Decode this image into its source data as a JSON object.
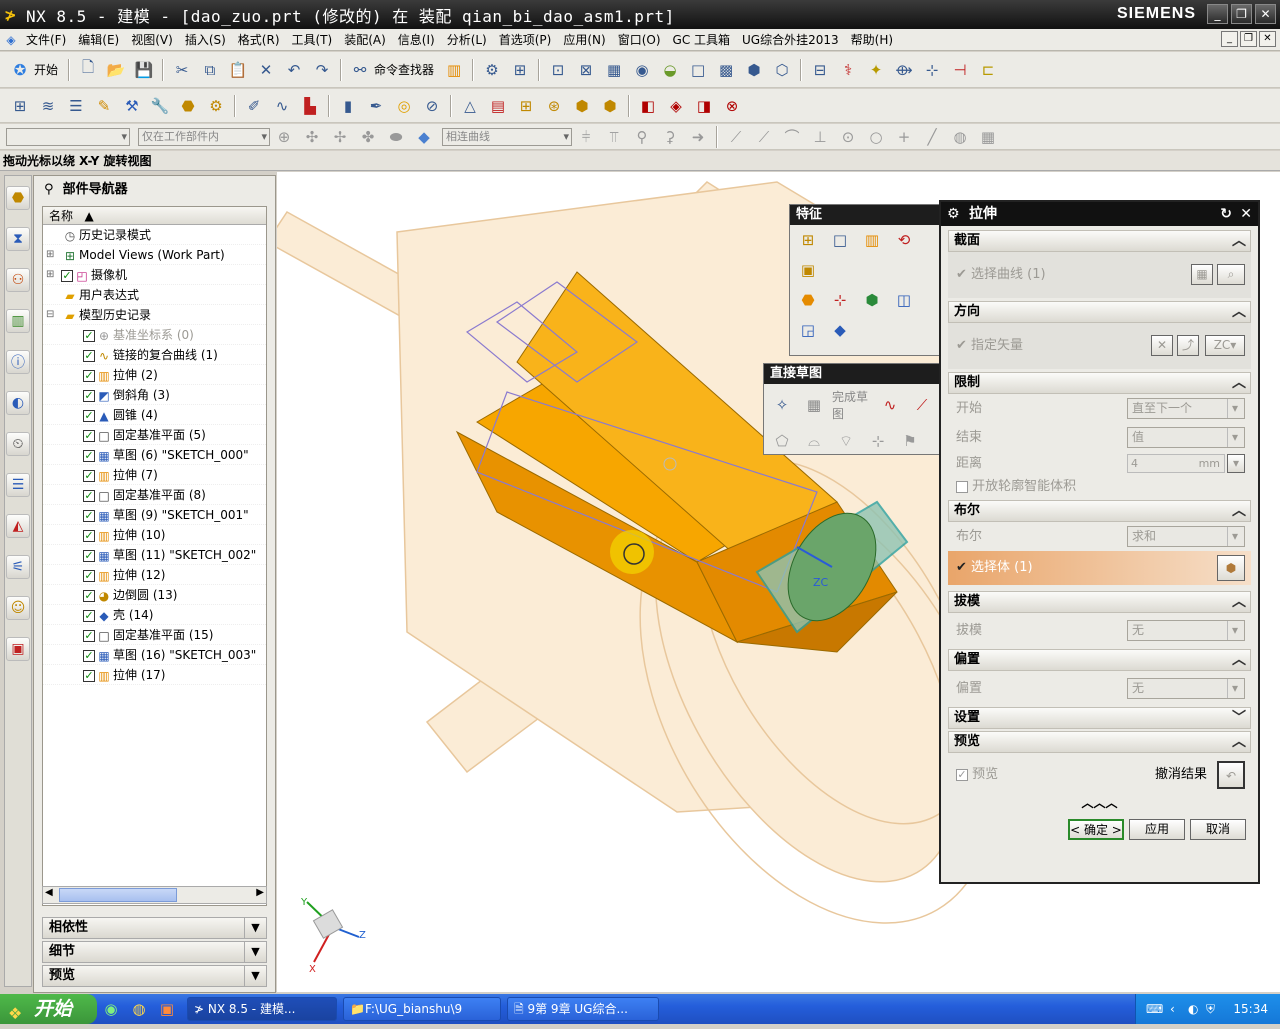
{
  "window": {
    "title": "NX 8.5 - 建模 - [dao_zuo.prt  (修改的)   在 装配 qian_bi_dao_asm1.prt]",
    "brand": "SIEMENS"
  },
  "menu": [
    "文件(F)",
    "编辑(E)",
    "视图(V)",
    "插入(S)",
    "格式(R)",
    "工具(T)",
    "装配(A)",
    "信息(I)",
    "分析(L)",
    "首选项(P)",
    "应用(N)",
    "窗口(O)",
    "GC 工具箱",
    "UG综合外挂2013",
    "帮助(H)"
  ],
  "toolbar": {
    "start_label": "开始",
    "command_finder": "命令查找器",
    "filter_combo": "仅在工作部件内",
    "curve_combo": "相连曲线"
  },
  "statusbar": {
    "hint": "拖动光标以绕 X-Y 旋转视图"
  },
  "navigator": {
    "title": "部件导航器",
    "column_name": "名称",
    "items": [
      {
        "label": "历史记录模式",
        "icon": "clock-icon",
        "checked": false,
        "expander": "",
        "dim": false
      },
      {
        "label": "Model Views (Work Part)",
        "icon": "views-icon",
        "checked": false,
        "expander": "+",
        "dim": false
      },
      {
        "label": "摄像机",
        "icon": "camera-icon",
        "checked": true,
        "expander": "+",
        "dim": false
      },
      {
        "label": "用户表达式",
        "icon": "folder-icon",
        "checked": false,
        "expander": "",
        "dim": false
      },
      {
        "label": "模型历史记录",
        "icon": "folder-icon",
        "checked": false,
        "expander": "-",
        "dim": false
      },
      {
        "label": "基准坐标系  (0)",
        "icon": "csys-icon",
        "checked": true,
        "expander": "",
        "dim": true
      },
      {
        "label": "链接的复合曲线  (1)",
        "icon": "curve-icon",
        "checked": true,
        "expander": "",
        "dim": false
      },
      {
        "label": "拉伸  (2)",
        "icon": "extrude-icon",
        "checked": true,
        "expander": "",
        "dim": false
      },
      {
        "label": "倒斜角  (3)",
        "icon": "chamfer-icon",
        "checked": true,
        "expander": "",
        "dim": false
      },
      {
        "label": "圆锥  (4)",
        "icon": "cone-icon",
        "checked": true,
        "expander": "",
        "dim": false
      },
      {
        "label": "固定基准平面  (5)",
        "icon": "plane-icon",
        "checked": true,
        "expander": "",
        "dim": false
      },
      {
        "label": "草图  (6) \"SKETCH_000\"",
        "icon": "sketch-icon",
        "checked": true,
        "expander": "",
        "dim": false
      },
      {
        "label": "拉伸  (7)",
        "icon": "extrude-icon",
        "checked": true,
        "expander": "",
        "dim": false
      },
      {
        "label": "固定基准平面  (8)",
        "icon": "plane-icon",
        "checked": true,
        "expander": "",
        "dim": false
      },
      {
        "label": "草图  (9) \"SKETCH_001\"",
        "icon": "sketch-icon",
        "checked": true,
        "expander": "",
        "dim": false
      },
      {
        "label": "拉伸  (10)",
        "icon": "extrude-icon",
        "checked": true,
        "expander": "",
        "dim": false
      },
      {
        "label": "草图  (11) \"SKETCH_002\"",
        "icon": "sketch-icon",
        "checked": true,
        "expander": "",
        "dim": false
      },
      {
        "label": "拉伸  (12)",
        "icon": "extrude-icon",
        "checked": true,
        "expander": "",
        "dim": false
      },
      {
        "label": "边倒圆  (13)",
        "icon": "blend-icon",
        "checked": true,
        "expander": "",
        "dim": false
      },
      {
        "label": "壳  (14)",
        "icon": "shell-icon",
        "checked": true,
        "expander": "",
        "dim": false
      },
      {
        "label": "固定基准平面  (15)",
        "icon": "plane-icon",
        "checked": true,
        "expander": "",
        "dim": false
      },
      {
        "label": "草图  (16) \"SKETCH_003\"",
        "icon": "sketch-icon",
        "checked": true,
        "expander": "",
        "dim": false
      },
      {
        "label": "拉伸  (17)",
        "icon": "extrude-icon",
        "checked": true,
        "expander": "",
        "dim": false
      }
    ],
    "panels": [
      "相依性",
      "细节",
      "预览"
    ]
  },
  "palettes": {
    "features_title": "特征",
    "sketch_title": "直接草图",
    "finish_sketch": "完成草图"
  },
  "dialog": {
    "title": "拉伸",
    "sections": {
      "section": "截面",
      "direction": "方向",
      "limits": "限制",
      "boolean": "布尔",
      "draft": "拔模",
      "offset": "偏置",
      "settings": "设置",
      "preview": "预览"
    },
    "select_curve": "选择曲线 (1)",
    "specify_vector": "指定矢量",
    "start_label": "开始",
    "start_value": "直至下一个",
    "end_label": "结束",
    "end_value": "值",
    "distance_label": "距离",
    "distance_value": "4",
    "distance_unit": "mm",
    "open_profile": "开放轮廓智能体积",
    "boolean_label": "布尔",
    "boolean_value": "求和",
    "select_body": "选择体 (1)",
    "draft_label": "拔模",
    "draft_value": "无",
    "offset_label": "偏置",
    "offset_value": "无",
    "preview_label": "预览",
    "undo_result": "撤消结果",
    "ok": "< 确定 >",
    "apply": "应用",
    "cancel": "取消"
  },
  "triad": {
    "x": "X",
    "y": "Y",
    "z": "Z"
  },
  "taskbar": {
    "start": "开始",
    "tasks": [
      "NX 8.5 - 建模...",
      "F:\\UG_bianshu\\9",
      "9第 9章 UG综合..."
    ],
    "clock": "15:34"
  },
  "colors": {
    "accent_orange": "#f5a623",
    "title_bg": "#111111",
    "body_highlight": "#e8a15a",
    "part_ghost": "#f7e7cc"
  }
}
